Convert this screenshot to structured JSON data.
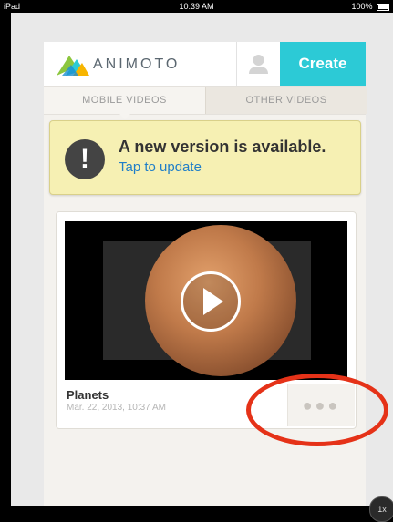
{
  "status_bar": {
    "device": "iPad",
    "time": "10:39 AM",
    "battery": "100%"
  },
  "header": {
    "brand": "ANIMOTO",
    "create_label": "Create"
  },
  "tabs": [
    {
      "label": "MOBILE VIDEOS"
    },
    {
      "label": "OTHER VIDEOS"
    }
  ],
  "update_banner": {
    "icon_glyph": "!",
    "title": "A new version is available.",
    "subtitle": "Tap to update"
  },
  "video": {
    "title": "Planets",
    "date": "Mar. 22, 2013, 10:37 AM",
    "more_glyph": "●●●"
  },
  "zoom_badge": "1x",
  "colors": {
    "accent": "#2ccad6",
    "banner_bg": "#f6f0b3",
    "link": "#1f7ec8",
    "annotation": "#e53218"
  }
}
